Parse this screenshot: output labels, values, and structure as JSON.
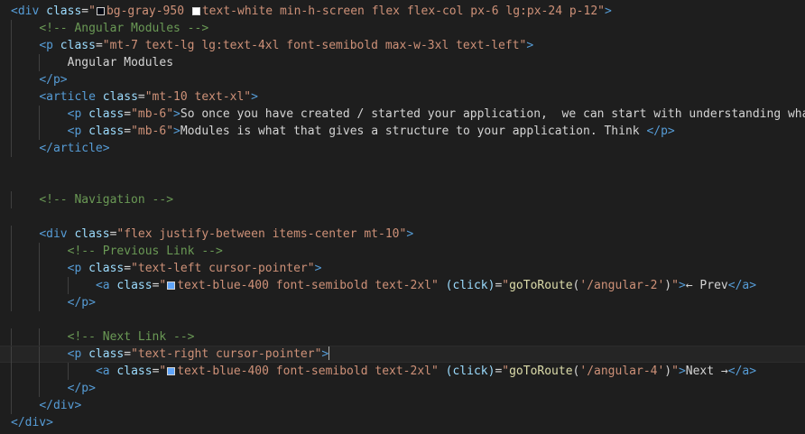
{
  "editor": {
    "colors": {
      "background": "#1e1e1e",
      "tag": "#569cd6",
      "attribute": "#9cdcfe",
      "string": "#ce9178",
      "comment": "#6a9955",
      "text": "#d4d4d4",
      "swatch_gray_950": "#030712",
      "swatch_white": "#ffffff",
      "swatch_blue_400": "#60a5fa"
    },
    "lines": [
      {
        "indent": 0,
        "tokens": [
          {
            "k": "t",
            "v": "<div"
          },
          {
            "k": "x",
            "v": " "
          },
          {
            "k": "a",
            "v": "class"
          },
          {
            "k": "x",
            "v": "="
          },
          {
            "k": "s",
            "v": "\""
          },
          {
            "k": "sw",
            "v": "#030712"
          },
          {
            "k": "s",
            "v": "bg-gray-950 "
          },
          {
            "k": "sw",
            "v": "#ffffff"
          },
          {
            "k": "s",
            "v": "text-white min-h-screen flex flex-col px-6 lg:px-24 p-12\""
          },
          {
            "k": "t",
            "v": ">"
          }
        ]
      },
      {
        "indent": 1,
        "tokens": [
          {
            "k": "c",
            "v": "<!-- Angular Modules -->"
          }
        ]
      },
      {
        "indent": 1,
        "tokens": [
          {
            "k": "t",
            "v": "<p"
          },
          {
            "k": "x",
            "v": " "
          },
          {
            "k": "a",
            "v": "class"
          },
          {
            "k": "x",
            "v": "="
          },
          {
            "k": "s",
            "v": "\"mt-7 text-lg lg:text-4xl font-semibold max-w-3xl text-left\""
          },
          {
            "k": "t",
            "v": ">"
          }
        ]
      },
      {
        "indent": 2,
        "tokens": [
          {
            "k": "x",
            "v": "Angular Modules"
          }
        ]
      },
      {
        "indent": 1,
        "tokens": [
          {
            "k": "t",
            "v": "</p>"
          }
        ]
      },
      {
        "indent": 1,
        "tokens": [
          {
            "k": "t",
            "v": "<article"
          },
          {
            "k": "x",
            "v": " "
          },
          {
            "k": "a",
            "v": "class"
          },
          {
            "k": "x",
            "v": "="
          },
          {
            "k": "s",
            "v": "\"mt-10 text-xl\""
          },
          {
            "k": "t",
            "v": ">"
          }
        ]
      },
      {
        "indent": 2,
        "tokens": [
          {
            "k": "t",
            "v": "<p"
          },
          {
            "k": "x",
            "v": " "
          },
          {
            "k": "a",
            "v": "class"
          },
          {
            "k": "x",
            "v": "="
          },
          {
            "k": "s",
            "v": "\"mb-6\""
          },
          {
            "k": "t",
            "v": ">"
          },
          {
            "k": "x",
            "v": "So once you have created / started your application,  we can start with understanding what"
          }
        ]
      },
      {
        "indent": 2,
        "tokens": [
          {
            "k": "t",
            "v": "<p"
          },
          {
            "k": "x",
            "v": " "
          },
          {
            "k": "a",
            "v": "class"
          },
          {
            "k": "x",
            "v": "="
          },
          {
            "k": "s",
            "v": "\"mb-6\""
          },
          {
            "k": "t",
            "v": ">"
          },
          {
            "k": "x",
            "v": "Modules is what that gives a structure to your application. Think "
          },
          {
            "k": "t",
            "v": "</p>"
          }
        ]
      },
      {
        "indent": 1,
        "tokens": [
          {
            "k": "t",
            "v": "</article>"
          }
        ]
      },
      {
        "indent": 0,
        "tokens": []
      },
      {
        "indent": 0,
        "tokens": []
      },
      {
        "indent": 1,
        "tokens": [
          {
            "k": "c",
            "v": "<!-- Navigation -->"
          }
        ]
      },
      {
        "indent": 0,
        "tokens": []
      },
      {
        "indent": 1,
        "tokens": [
          {
            "k": "t",
            "v": "<div"
          },
          {
            "k": "x",
            "v": " "
          },
          {
            "k": "a",
            "v": "class"
          },
          {
            "k": "x",
            "v": "="
          },
          {
            "k": "s",
            "v": "\"flex justify-between items-center mt-10\""
          },
          {
            "k": "t",
            "v": ">"
          }
        ]
      },
      {
        "indent": 2,
        "tokens": [
          {
            "k": "c",
            "v": "<!-- Previous Link -->"
          }
        ]
      },
      {
        "indent": 2,
        "tokens": [
          {
            "k": "t",
            "v": "<p"
          },
          {
            "k": "x",
            "v": " "
          },
          {
            "k": "a",
            "v": "class"
          },
          {
            "k": "x",
            "v": "="
          },
          {
            "k": "s",
            "v": "\"text-left cursor-pointer\""
          },
          {
            "k": "t",
            "v": ">"
          }
        ]
      },
      {
        "indent": 3,
        "tokens": [
          {
            "k": "t",
            "v": "<a"
          },
          {
            "k": "x",
            "v": " "
          },
          {
            "k": "a",
            "v": "class"
          },
          {
            "k": "x",
            "v": "="
          },
          {
            "k": "s",
            "v": "\""
          },
          {
            "k": "sw",
            "v": "#60a5fa"
          },
          {
            "k": "s",
            "v": "text-blue-400 font-semibold text-2xl\""
          },
          {
            "k": "x",
            "v": " "
          },
          {
            "k": "a",
            "v": "(click)"
          },
          {
            "k": "x",
            "v": "="
          },
          {
            "k": "s",
            "v": "\""
          },
          {
            "k": "f",
            "v": "goToRoute"
          },
          {
            "k": "x",
            "v": "("
          },
          {
            "k": "s",
            "v": "'/angular-2'"
          },
          {
            "k": "x",
            "v": ")"
          },
          {
            "k": "s",
            "v": "\""
          },
          {
            "k": "t",
            "v": ">"
          },
          {
            "k": "x",
            "v": "← Prev"
          },
          {
            "k": "t",
            "v": "</a>"
          }
        ]
      },
      {
        "indent": 2,
        "tokens": [
          {
            "k": "t",
            "v": "</p>"
          }
        ]
      },
      {
        "indent": 0,
        "tokens": []
      },
      {
        "indent": 2,
        "tokens": [
          {
            "k": "c",
            "v": "<!-- Next Link -->"
          }
        ]
      },
      {
        "indent": 2,
        "current": true,
        "tokens": [
          {
            "k": "t",
            "v": "<p"
          },
          {
            "k": "x",
            "v": " "
          },
          {
            "k": "a",
            "v": "class"
          },
          {
            "k": "x",
            "v": "="
          },
          {
            "k": "s",
            "v": "\"text-right cursor-pointer\""
          },
          {
            "k": "t",
            "v": ">"
          },
          {
            "k": "caret",
            "v": ""
          }
        ]
      },
      {
        "indent": 3,
        "tokens": [
          {
            "k": "t",
            "v": "<a"
          },
          {
            "k": "x",
            "v": " "
          },
          {
            "k": "a",
            "v": "class"
          },
          {
            "k": "x",
            "v": "="
          },
          {
            "k": "s",
            "v": "\""
          },
          {
            "k": "sw",
            "v": "#60a5fa"
          },
          {
            "k": "s",
            "v": "text-blue-400 font-semibold text-2xl\""
          },
          {
            "k": "x",
            "v": " "
          },
          {
            "k": "a",
            "v": "(click)"
          },
          {
            "k": "x",
            "v": "="
          },
          {
            "k": "s",
            "v": "\""
          },
          {
            "k": "f",
            "v": "goToRoute"
          },
          {
            "k": "x",
            "v": "("
          },
          {
            "k": "s",
            "v": "'/angular-4'"
          },
          {
            "k": "x",
            "v": ")"
          },
          {
            "k": "s",
            "v": "\""
          },
          {
            "k": "t",
            "v": ">"
          },
          {
            "k": "x",
            "v": "Next →"
          },
          {
            "k": "t",
            "v": "</a>"
          }
        ]
      },
      {
        "indent": 2,
        "tokens": [
          {
            "k": "t",
            "v": "</p>"
          }
        ]
      },
      {
        "indent": 1,
        "tokens": [
          {
            "k": "t",
            "v": "</div>"
          }
        ]
      },
      {
        "indent": 0,
        "tokens": [
          {
            "k": "t",
            "v": "</div>"
          }
        ]
      }
    ]
  }
}
